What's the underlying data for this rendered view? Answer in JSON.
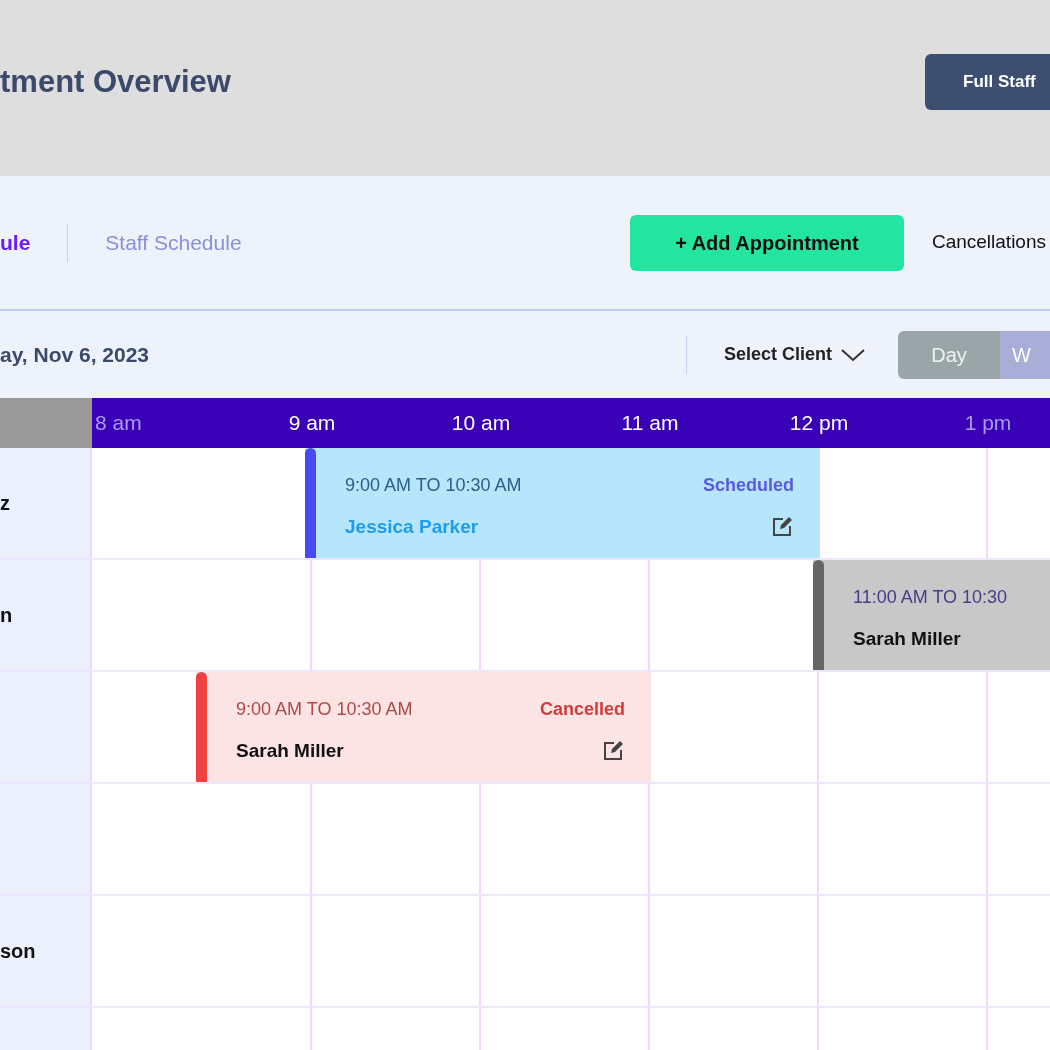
{
  "page": {
    "title": "tment Overview",
    "header_button": "Full Staff"
  },
  "tabs": [
    {
      "label": "ule",
      "selected": true
    },
    {
      "label": "Staff Schedule",
      "selected": false
    }
  ],
  "actions": {
    "add_button": "+ Add Appointment",
    "cancellations": "Cancellations"
  },
  "filter_bar": {
    "date": "ay, Nov 6, 2023",
    "client_select": "Select Client",
    "view_toggle": [
      {
        "label": "Day",
        "selected": true
      },
      {
        "label": "W",
        "selected": false
      }
    ]
  },
  "timeline": {
    "hours": [
      "8 am",
      "9 am",
      "10 am",
      "11 am",
      "12 pm",
      "1 pm"
    ],
    "staff": [
      {
        "kind": "staff",
        "name": "z",
        "appointments": [
          {
            "kind": "scheduled",
            "time": "9:00 AM TO 10:30 AM",
            "status": "Scheduled",
            "client": "Jessica Parker",
            "editable": true
          }
        ]
      },
      {
        "kind": "staff",
        "name": "n",
        "appointments": [
          {
            "kind": "other",
            "time": "11:00 AM TO 10:30",
            "client": "Sarah Miller",
            "editable": false
          }
        ]
      },
      {
        "kind": "staff",
        "appointments": [
          {
            "kind": "cancelled",
            "time": "9:00 AM TO 10:30 AM",
            "status": "Cancelled",
            "client": "Sarah Miller",
            "editable": true
          }
        ]
      },
      {
        "kind": "staff"
      },
      {
        "kind": "staff",
        "name": "son"
      },
      {
        "kind": "staff"
      }
    ]
  }
}
